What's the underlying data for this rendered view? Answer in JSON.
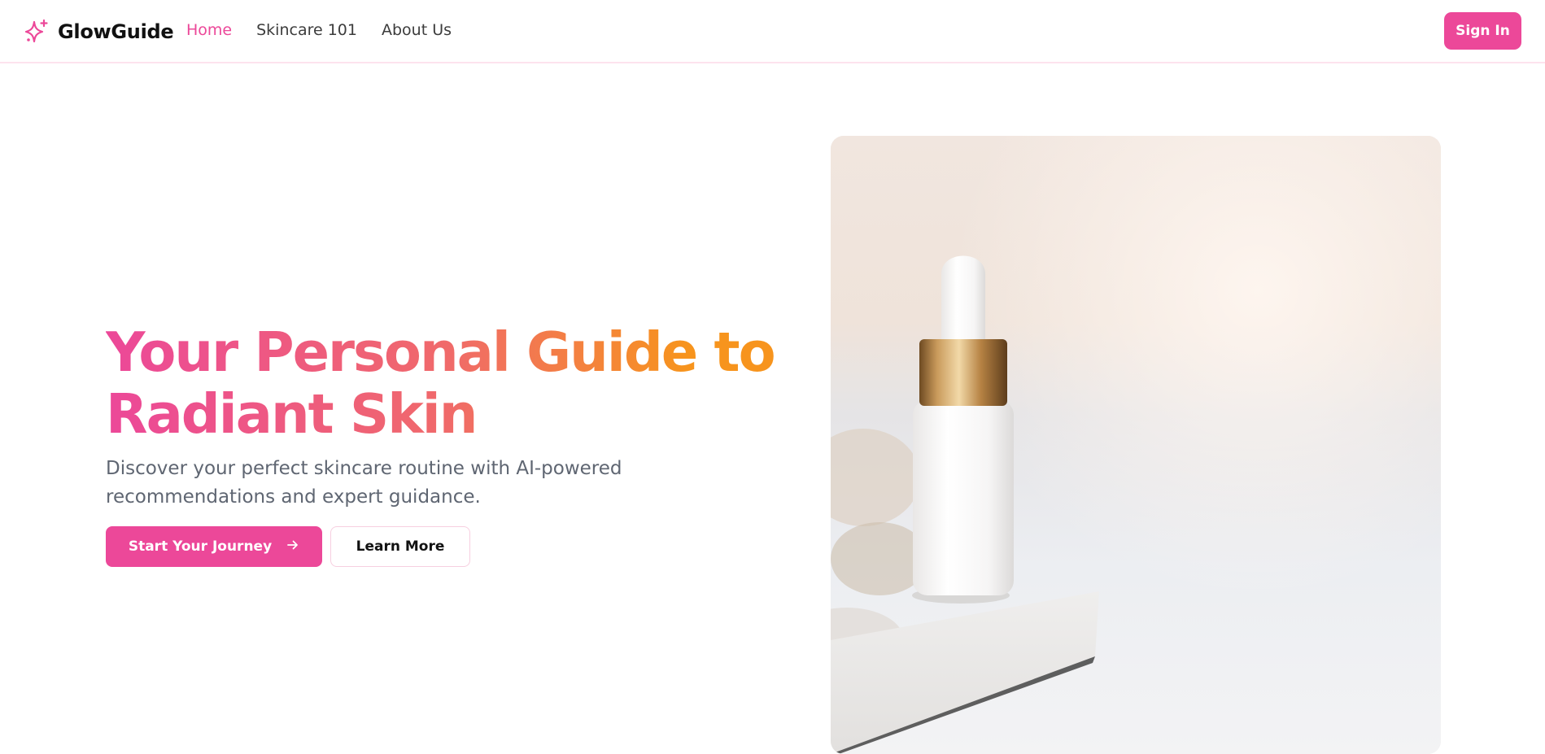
{
  "brand": {
    "name": "GlowGuide",
    "icon": "sparkles-icon",
    "accent_color": "#ec4899"
  },
  "nav": {
    "links": [
      {
        "label": "Home",
        "active": true
      },
      {
        "label": "Skincare 101",
        "active": false
      },
      {
        "label": "About Us",
        "active": false
      }
    ],
    "signin_label": "Sign In"
  },
  "hero": {
    "title_line1": "Your Personal Guide to",
    "title_line2": "Radiant Skin",
    "subtitle": "Discover your perfect skincare routine with AI-powered recommendations and expert guidance.",
    "primary_cta": "Start Your Journey",
    "primary_cta_icon": "arrow-right-icon",
    "secondary_cta": "Learn More",
    "gradient_colors": [
      "#ec4899",
      "#f06a6a",
      "#f7941d"
    ]
  },
  "image": {
    "subject": "serum-dropper-bottle-image"
  }
}
